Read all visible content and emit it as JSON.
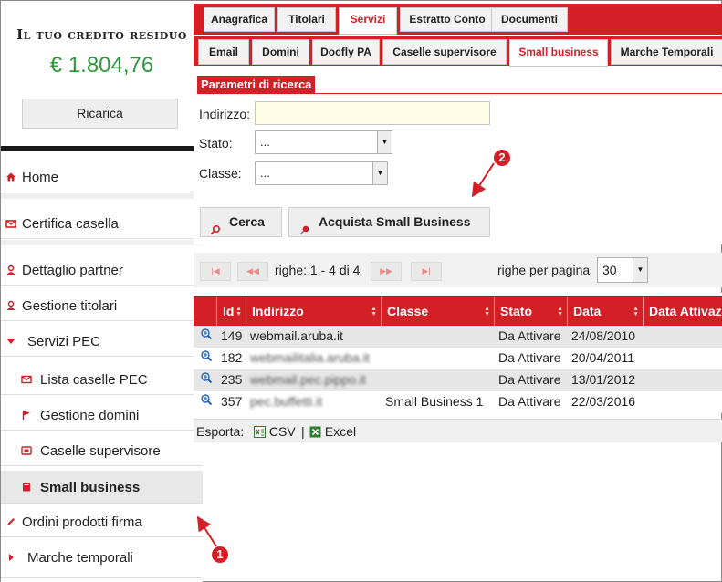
{
  "credit": {
    "title": "Il tuo credito residuo",
    "amount": "€ 1.804,76",
    "recharge_label": "Ricarica"
  },
  "sidebar": {
    "items": [
      {
        "label": "Home",
        "icon": "home-icon"
      },
      {
        "label": "Certifica casella",
        "icon": "envelope-icon"
      },
      {
        "label": "Dettaglio partner",
        "icon": "user-icon"
      },
      {
        "label": "Gestione titolari",
        "icon": "user-icon"
      },
      {
        "label": "Servizi PEC",
        "icon": "caret-down-icon"
      },
      {
        "label": "Lista caselle PEC",
        "icon": "mail-icon"
      },
      {
        "label": "Gestione domini",
        "icon": "flag-icon"
      },
      {
        "label": "Caselle supervisore",
        "icon": "inbox-icon"
      },
      {
        "label": "Small  business",
        "icon": "square-icon"
      },
      {
        "label": "Ordini prodotti firma",
        "icon": "pencil-icon"
      },
      {
        "label": "Marche temporali",
        "icon": "caret-right-icon"
      }
    ]
  },
  "tabs_main": [
    "Anagrafica",
    "Titolari",
    "Servizi",
    "Estratto Conto",
    "Documenti"
  ],
  "tabs_sub": [
    "Email",
    "Domini",
    "Docfly PA",
    "Caselle supervisore",
    "Small business",
    "Marche Temporali"
  ],
  "search": {
    "title": "Parametri di ricerca",
    "address_label": "Indirizzo:",
    "address_value": "",
    "status_label": "Stato:",
    "status_value": "...",
    "class_label": "Classe:",
    "class_value": "...",
    "search_button": "Cerca",
    "buy_button": "Acquista Small Business"
  },
  "pager": {
    "info": "righe: 1 - 4 di 4",
    "rows_per_page_label": "righe per pagina",
    "rows_per_page_value": "30"
  },
  "table": {
    "columns": [
      "Id",
      "Indirizzo",
      "Classe",
      "Stato",
      "Data",
      "Data Attivaz"
    ],
    "rows": [
      {
        "id": "149",
        "address": "webmail.aruba.it",
        "class": "",
        "status": "Da Attivare",
        "date": "24/08/2010"
      },
      {
        "id": "182",
        "address": "webmailitalia.aruba.it",
        "class": "",
        "status": "Da Attivare",
        "date": "20/04/2011"
      },
      {
        "id": "235",
        "address": "webmail.pec.pippo.it",
        "class": "",
        "status": "Da Attivare",
        "date": "13/01/2012"
      },
      {
        "id": "357",
        "address": "pec.buffetti.it",
        "class": "Small Business 1",
        "status": "Da Attivare",
        "date": "22/03/2016"
      }
    ]
  },
  "export": {
    "label": "Esporta:",
    "csv": "CSV",
    "separator": "|",
    "excel": "Excel"
  },
  "callouts": [
    "1",
    "2"
  ],
  "colors": {
    "brand_red": "#d41f26",
    "credit_green": "#2e9a3e"
  }
}
